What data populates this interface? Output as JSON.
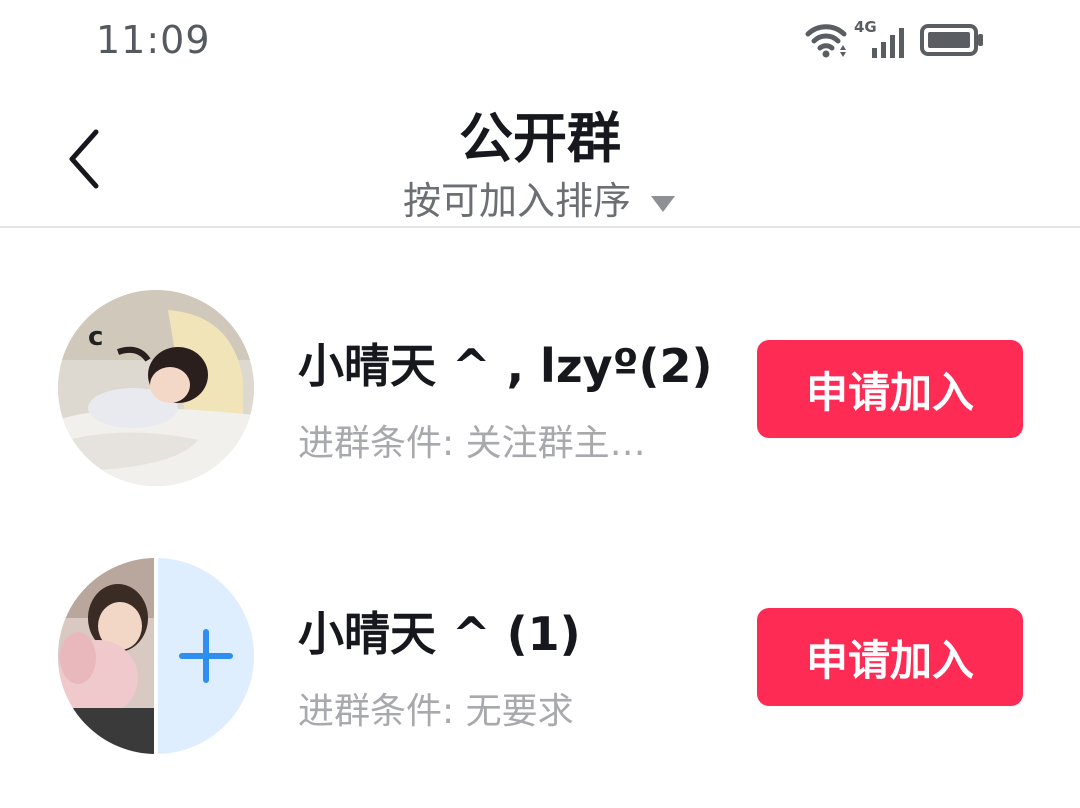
{
  "status_bar": {
    "time": "11:09",
    "network": "4G",
    "icons": [
      "wifi-icon",
      "signal-icon",
      "battery-icon"
    ]
  },
  "header": {
    "title": "公开群",
    "sort_label": "按可加入排序"
  },
  "groups": [
    {
      "name": "小晴天 ^ , lzyº(2)",
      "condition": "进群条件: 关注群主…",
      "button_label": "申请加入"
    },
    {
      "name": "小晴天 ^ (1)",
      "condition": "进群条件: 无要求",
      "button_label": "申请加入"
    }
  ],
  "colors": {
    "accent": "#fe2c55",
    "title": "#16181d",
    "muted": "#a8a9ad",
    "add_tile": "#dfeeff",
    "add_icon": "#2e8ff0"
  }
}
